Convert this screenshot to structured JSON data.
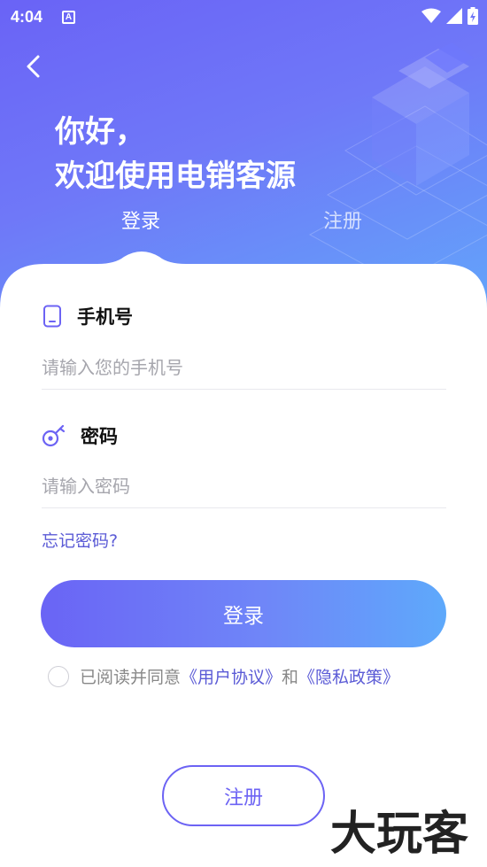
{
  "status_bar": {
    "time": "4:04",
    "notification_letter": "A"
  },
  "greeting": {
    "line1": "你好，",
    "line2": "欢迎使用电销客源"
  },
  "tabs": [
    {
      "label": "登录",
      "active": true
    },
    {
      "label": "注册",
      "active": false
    }
  ],
  "phone": {
    "label": "手机号",
    "placeholder": "请输入您的手机号",
    "value": "",
    "icon": "phone-icon"
  },
  "password": {
    "label": "密码",
    "placeholder": "请输入密码",
    "value": "",
    "icon": "key-icon"
  },
  "forgot_password": "忘记密码?",
  "login_button": "登录",
  "agreement": {
    "prefix": "已阅读并同意",
    "user_agreement": "《用户协议》",
    "conjunction": "和",
    "privacy_policy": "《隐私政策》",
    "checked": false
  },
  "register_button": "注册",
  "watermark": "大玩客",
  "colors": {
    "primary": "#6c63f4",
    "gradient_end": "#5ea9fb",
    "link": "#5b5bd6",
    "placeholder": "#a6a6ad"
  }
}
